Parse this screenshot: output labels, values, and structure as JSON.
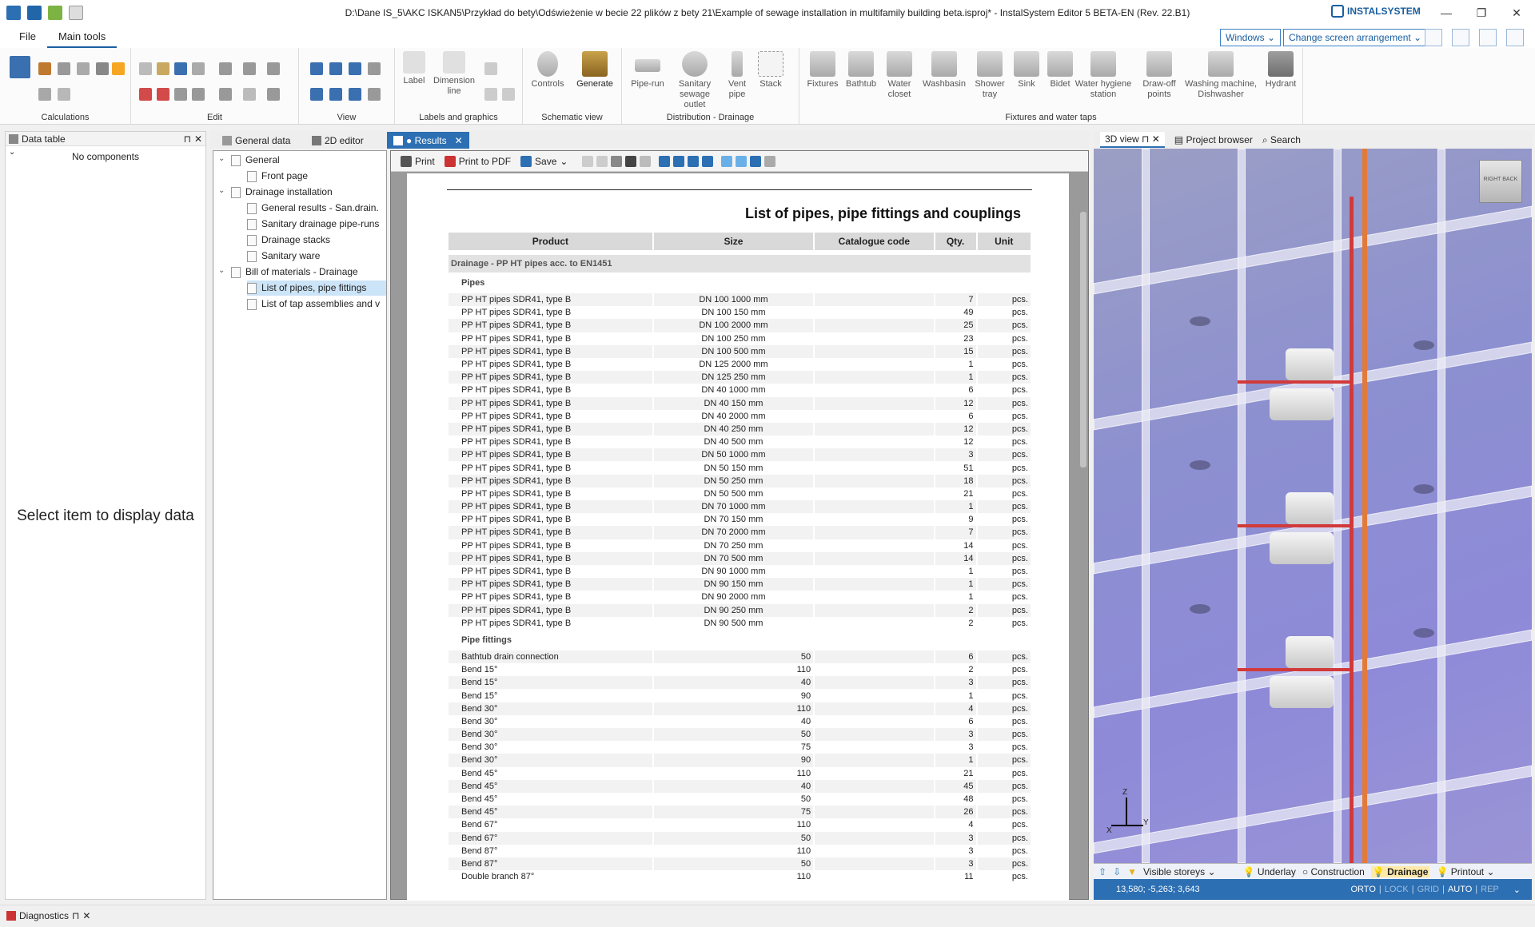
{
  "window": {
    "title": "D:\\Dane IS_5\\AKC ISKAN5\\Przykład do bety\\Odświeżenie w becie 22 plików z bety 21\\Example of sewage installation in multifamily building beta.isproj* - InstalSystem Editor 5 BETA-EN (Rev. 22.B1)",
    "brand": "INSTALSYSTEM"
  },
  "menu": {
    "file": "File",
    "main_tools": "Main tools",
    "windows": "Windows",
    "change_arrangement": "Change screen arrangement"
  },
  "ribbon": {
    "groups": {
      "calculations": "Calculations",
      "edit": "Edit",
      "view": "View",
      "labels": "Labels and graphics",
      "schematic": "Schematic view",
      "distribution": "Distribution - Drainage",
      "fixtures": "Fixtures and water taps"
    },
    "buttons": {
      "label": "Label",
      "dimension": "Dimension line",
      "controls": "Controls",
      "generate": "Generate",
      "piperun": "Pipe-run",
      "sanitary_outlet": "Sanitary sewage outlet",
      "vent_pipe": "Vent pipe",
      "stack": "Stack",
      "fixtures": "Fixtures",
      "bathtub": "Bathtub",
      "water_closet": "Water closet",
      "washbasin": "Washbasin",
      "shower_tray": "Shower tray",
      "sink": "Sink",
      "bidet": "Bidet",
      "hygiene_station": "Water hygiene station",
      "drawoff": "Draw-off points",
      "washing_machine": "Washing machine, Dishwasher",
      "hydrant": "Hydrant"
    }
  },
  "left_panel": {
    "title": "Data table",
    "no_components": "No components",
    "placeholder": "Select item to display data"
  },
  "tabs": {
    "general_data": "General data",
    "editor_2d": "2D editor",
    "results": "● Results"
  },
  "tree": {
    "general": "General",
    "front_page": "Front page",
    "drainage": "Drainage installation",
    "general_results": "General results - San.drain.",
    "sanitary_piperuns": "Sanitary drainage pipe-runs",
    "drainage_stacks": "Drainage stacks",
    "sanitary_ware": "Sanitary ware",
    "bom": "Bill of materials - Drainage",
    "list_pipes": "List of pipes, pipe fittings",
    "list_tap": "List of tap assemblies and v"
  },
  "doc_toolbar": {
    "print": "Print",
    "print_pdf": "Print to PDF",
    "save": "Save"
  },
  "document": {
    "title": "List of pipes, pipe fittings and couplings",
    "columns": [
      "Product",
      "Size",
      "Catalogue code",
      "Qty.",
      "Unit"
    ],
    "group": "Drainage - PP HT pipes acc. to EN1451",
    "pipes_label": "Pipes",
    "pipes": [
      [
        "PP HT pipes SDR41, type B",
        "DN 100 1000 mm",
        "7",
        "pcs."
      ],
      [
        "PP HT pipes SDR41, type B",
        "DN 100 150 mm",
        "49",
        "pcs."
      ],
      [
        "PP HT pipes SDR41, type B",
        "DN 100 2000 mm",
        "25",
        "pcs."
      ],
      [
        "PP HT pipes SDR41, type B",
        "DN 100 250 mm",
        "23",
        "pcs."
      ],
      [
        "PP HT pipes SDR41, type B",
        "DN 100 500 mm",
        "15",
        "pcs."
      ],
      [
        "PP HT pipes SDR41, type B",
        "DN 125 2000 mm",
        "1",
        "pcs."
      ],
      [
        "PP HT pipes SDR41, type B",
        "DN 125 250 mm",
        "1",
        "pcs."
      ],
      [
        "PP HT pipes SDR41, type B",
        "DN 40 1000 mm",
        "6",
        "pcs."
      ],
      [
        "PP HT pipes SDR41, type B",
        "DN 40 150 mm",
        "12",
        "pcs."
      ],
      [
        "PP HT pipes SDR41, type B",
        "DN 40 2000 mm",
        "6",
        "pcs."
      ],
      [
        "PP HT pipes SDR41, type B",
        "DN 40 250 mm",
        "12",
        "pcs."
      ],
      [
        "PP HT pipes SDR41, type B",
        "DN 40 500 mm",
        "12",
        "pcs."
      ],
      [
        "PP HT pipes SDR41, type B",
        "DN 50 1000 mm",
        "3",
        "pcs."
      ],
      [
        "PP HT pipes SDR41, type B",
        "DN 50 150 mm",
        "51",
        "pcs."
      ],
      [
        "PP HT pipes SDR41, type B",
        "DN 50 250 mm",
        "18",
        "pcs."
      ],
      [
        "PP HT pipes SDR41, type B",
        "DN 50 500 mm",
        "21",
        "pcs."
      ],
      [
        "PP HT pipes SDR41, type B",
        "DN 70 1000 mm",
        "1",
        "pcs."
      ],
      [
        "PP HT pipes SDR41, type B",
        "DN 70 150 mm",
        "9",
        "pcs."
      ],
      [
        "PP HT pipes SDR41, type B",
        "DN 70 2000 mm",
        "7",
        "pcs."
      ],
      [
        "PP HT pipes SDR41, type B",
        "DN 70 250 mm",
        "14",
        "pcs."
      ],
      [
        "PP HT pipes SDR41, type B",
        "DN 70 500 mm",
        "14",
        "pcs."
      ],
      [
        "PP HT pipes SDR41, type B",
        "DN 90 1000 mm",
        "1",
        "pcs."
      ],
      [
        "PP HT pipes SDR41, type B",
        "DN 90 150 mm",
        "1",
        "pcs."
      ],
      [
        "PP HT pipes SDR41, type B",
        "DN 90 2000 mm",
        "1",
        "pcs."
      ],
      [
        "PP HT pipes SDR41, type B",
        "DN 90 250 mm",
        "2",
        "pcs."
      ],
      [
        "PP HT pipes SDR41, type B",
        "DN 90 500 mm",
        "2",
        "pcs."
      ]
    ],
    "fittings_label": "Pipe fittings",
    "fittings": [
      [
        "Bathtub drain connection",
        "50",
        "6",
        "pcs."
      ],
      [
        "Bend 15°",
        "110",
        "2",
        "pcs."
      ],
      [
        "Bend 15°",
        "40",
        "3",
        "pcs."
      ],
      [
        "Bend 15°",
        "90",
        "1",
        "pcs."
      ],
      [
        "Bend 30°",
        "110",
        "4",
        "pcs."
      ],
      [
        "Bend 30°",
        "40",
        "6",
        "pcs."
      ],
      [
        "Bend 30°",
        "50",
        "3",
        "pcs."
      ],
      [
        "Bend 30°",
        "75",
        "3",
        "pcs."
      ],
      [
        "Bend 30°",
        "90",
        "1",
        "pcs."
      ],
      [
        "Bend 45°",
        "110",
        "21",
        "pcs."
      ],
      [
        "Bend 45°",
        "40",
        "45",
        "pcs."
      ],
      [
        "Bend 45°",
        "50",
        "48",
        "pcs."
      ],
      [
        "Bend 45°",
        "75",
        "26",
        "pcs."
      ],
      [
        "Bend 67°",
        "110",
        "4",
        "pcs."
      ],
      [
        "Bend 67°",
        "50",
        "3",
        "pcs."
      ],
      [
        "Bend 87°",
        "110",
        "3",
        "pcs."
      ],
      [
        "Bend 87°",
        "50",
        "3",
        "pcs."
      ],
      [
        "Double branch 87°",
        "110",
        "11",
        "pcs."
      ]
    ]
  },
  "right_panel": {
    "tabs": {
      "view3d": "3D view",
      "project_browser": "Project browser",
      "search": "Search"
    },
    "viewbar": {
      "visible_storeys": "Visible storeys",
      "underlay": "Underlay",
      "construction": "Construction",
      "drainage": "Drainage",
      "printout": "Printout"
    },
    "status": {
      "coords": "13,580; -5,263; 3,643",
      "orto": "ORTO",
      "lock": "LOCK",
      "grid": "GRID",
      "auto": "AUTO",
      "rep": "REP"
    },
    "cube": {
      "right": "RIGHT",
      "back": "BACK"
    }
  },
  "bottom": {
    "diagnostics": "Diagnostics"
  },
  "colors": {
    "accent": "#2c6fb3",
    "pipe": "#d23a3a",
    "view_bg": "#8e8ad8"
  }
}
